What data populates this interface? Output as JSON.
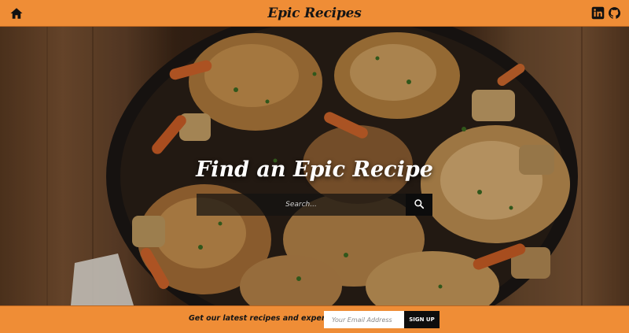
{
  "header": {
    "title": "Epic Recipes",
    "home_icon": "home-icon",
    "social_icons": [
      "linkedin-icon",
      "github-icon"
    ]
  },
  "hero": {
    "title": "Find an Epic Recipe",
    "search": {
      "placeholder": "Search...",
      "value": ""
    },
    "search_icon": "search-icon"
  },
  "footer": {
    "newsletter_text": "Get our latest recipes and expert tips",
    "email_placeholder": "Your Email Address",
    "email_value": "",
    "signup_label": "SIGN UP"
  },
  "colors": {
    "accent": "#ef8d36",
    "dark": "#0d0d0d",
    "text": "#151515"
  }
}
